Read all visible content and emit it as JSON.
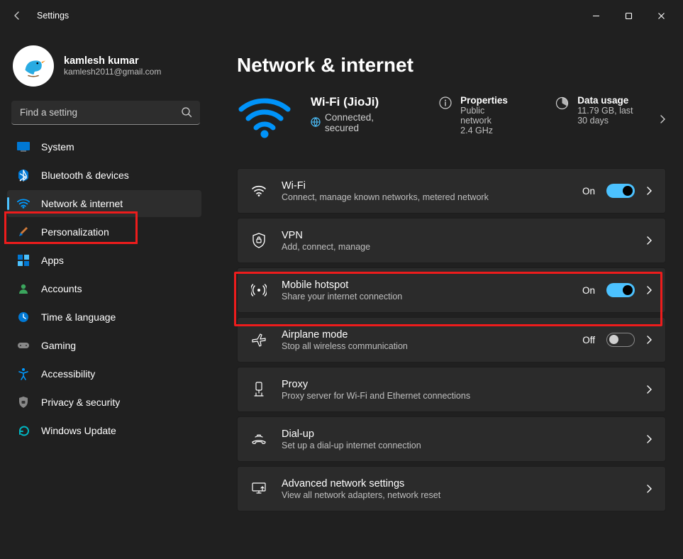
{
  "window": {
    "title": "Settings"
  },
  "user": {
    "name": "kamlesh kumar",
    "email": "kamlesh2011@gmail.com"
  },
  "search": {
    "placeholder": "Find a setting"
  },
  "sidebar": {
    "items": [
      {
        "label": "System"
      },
      {
        "label": "Bluetooth & devices"
      },
      {
        "label": "Network & internet"
      },
      {
        "label": "Personalization"
      },
      {
        "label": "Apps"
      },
      {
        "label": "Accounts"
      },
      {
        "label": "Time & language"
      },
      {
        "label": "Gaming"
      },
      {
        "label": "Accessibility"
      },
      {
        "label": "Privacy & security"
      },
      {
        "label": "Windows Update"
      }
    ]
  },
  "page": {
    "title": "Network & internet"
  },
  "status": {
    "ssid": "Wi-Fi (JioJi)",
    "state": "Connected, secured",
    "properties": {
      "title": "Properties",
      "sub": "Public network\n2.4 GHz"
    },
    "usage": {
      "title": "Data usage",
      "sub": "11.79 GB, last 30 days"
    }
  },
  "cards": {
    "wifi": {
      "title": "Wi-Fi",
      "sub": "Connect, manage known networks, metered network",
      "toggle": "On"
    },
    "vpn": {
      "title": "VPN",
      "sub": "Add, connect, manage"
    },
    "hotspot": {
      "title": "Mobile hotspot",
      "sub": "Share your internet connection",
      "toggle": "On"
    },
    "airplane": {
      "title": "Airplane mode",
      "sub": "Stop all wireless communication",
      "toggle": "Off"
    },
    "proxy": {
      "title": "Proxy",
      "sub": "Proxy server for Wi-Fi and Ethernet connections"
    },
    "dialup": {
      "title": "Dial-up",
      "sub": "Set up a dial-up internet connection"
    },
    "advanced": {
      "title": "Advanced network settings",
      "sub": "View all network adapters, network reset"
    }
  }
}
